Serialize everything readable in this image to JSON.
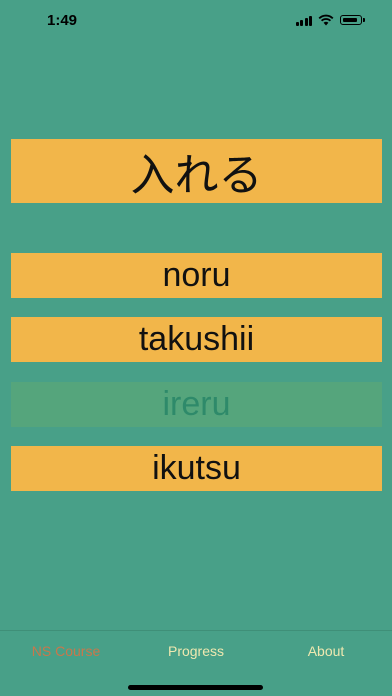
{
  "status": {
    "time": "1:49",
    "icons": [
      "signal-icon",
      "wifi-icon",
      "battery-icon"
    ]
  },
  "prompt": {
    "text": "入れる"
  },
  "options": [
    {
      "label": "noru",
      "state": "normal"
    },
    {
      "label": "takushii",
      "state": "normal"
    },
    {
      "label": "ireru",
      "state": "faded"
    },
    {
      "label": "ikutsu",
      "state": "normal"
    }
  ],
  "tabs": [
    {
      "label": "NS Course",
      "active": true
    },
    {
      "label": "Progress",
      "active": false
    },
    {
      "label": "About",
      "active": false
    }
  ],
  "colors": {
    "background": "#48a088",
    "card": "#f2b64a",
    "faded_card": "#55a57c",
    "active_tab": "#c9774b",
    "inactive_tab": "#efe8b0"
  }
}
